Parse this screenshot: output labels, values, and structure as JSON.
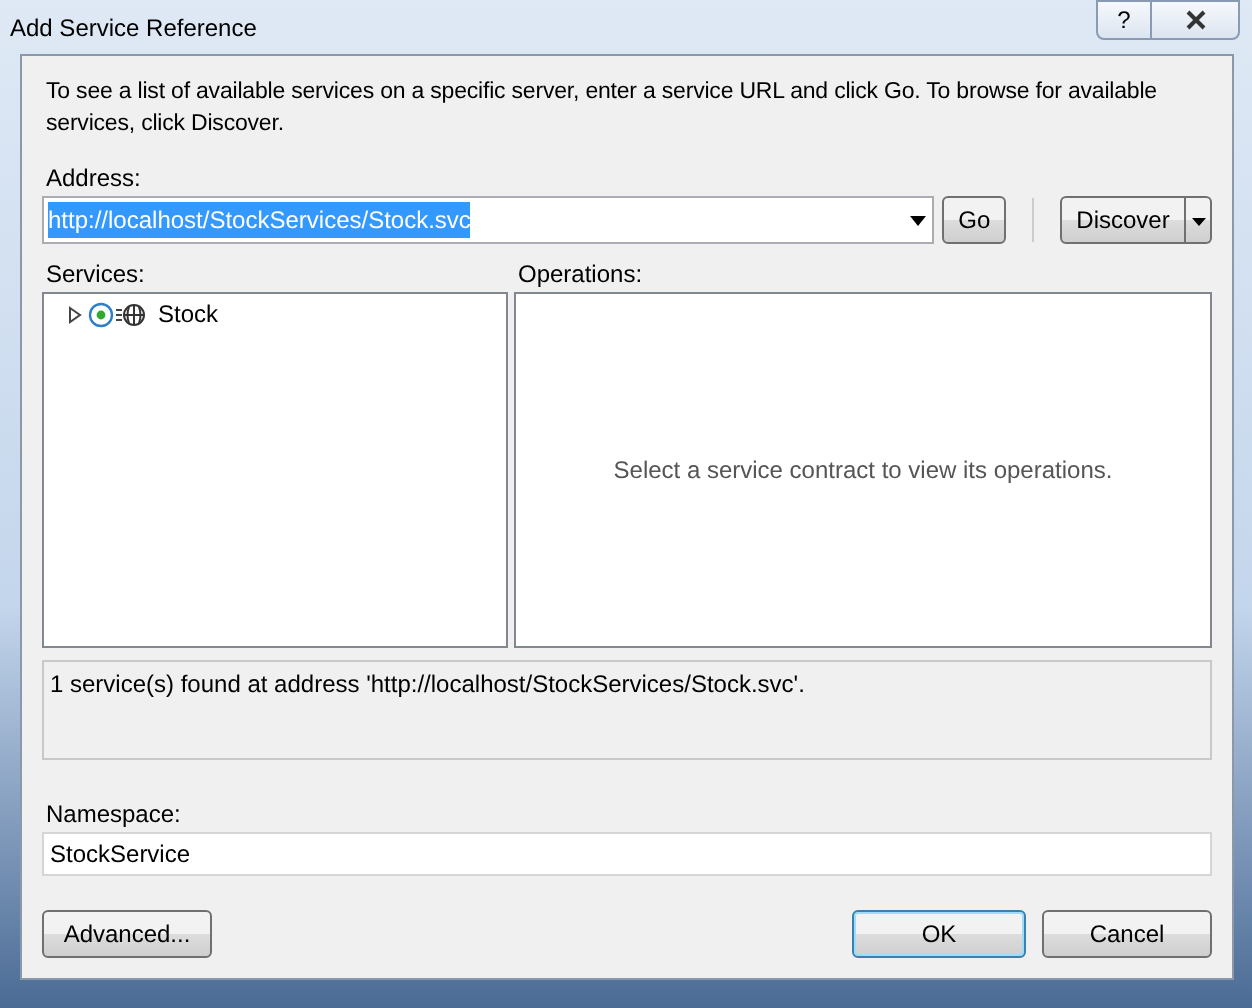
{
  "window": {
    "title": "Add Service Reference",
    "help_glyph": "?"
  },
  "intro": "To see a list of available services on a specific server, enter a service URL and click Go. To browse for available services, click Discover.",
  "address": {
    "label": "Address:",
    "value": "http://localhost/StockServices/Stock.svc",
    "text_selected": true
  },
  "go_button": "Go",
  "discover_button": "Discover",
  "services": {
    "label": "Services:",
    "items": [
      {
        "label": "Stock",
        "expanded": false
      }
    ]
  },
  "operations": {
    "label": "Operations:",
    "empty_text": "Select a service contract to view its operations."
  },
  "status": "1 service(s) found at address 'http://localhost/StockServices/Stock.svc'.",
  "namespace": {
    "label": "Namespace:",
    "value": "StockService"
  },
  "buttons": [
    {
      "label": "Advanced...",
      "kind": "advanced"
    },
    {
      "label": "OK",
      "kind": "default"
    },
    {
      "label": "Cancel",
      "kind": "normal"
    }
  ]
}
